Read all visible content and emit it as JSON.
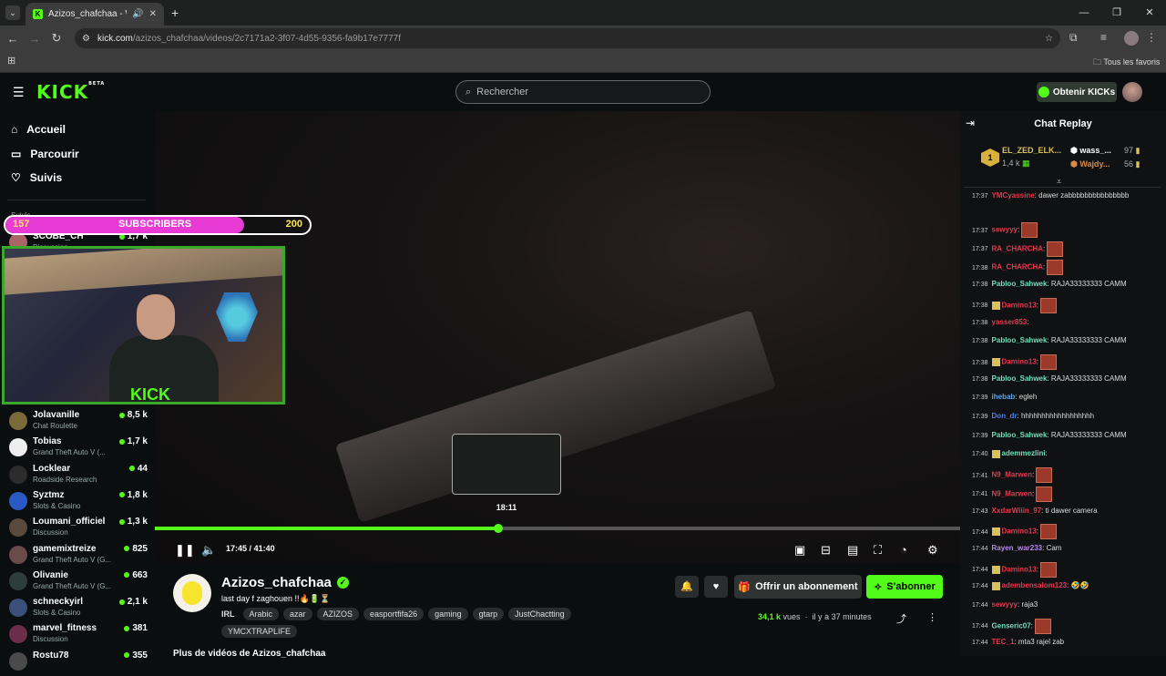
{
  "browser": {
    "tab_title": "Azizos_chafchaa - Watch th",
    "url_host": "kick.com",
    "url_path": "/azizos_chafchaa/videos/2c7171a2-3f07-4d55-9356-fa9b17e7777f",
    "bookmarks_label": "Tous les favoris"
  },
  "header": {
    "logo": "KICK",
    "logo_sup": "BETA",
    "search_placeholder": "Rechercher",
    "kicks_label": "Obtenir KICKs"
  },
  "sidebar": {
    "nav": [
      {
        "label": "Accueil",
        "icon": "home-icon"
      },
      {
        "label": "Parcourir",
        "icon": "compass-icon"
      },
      {
        "label": "Suivis",
        "icon": "heart-icon"
      }
    ],
    "section": "Suivis",
    "partial_channel": {
      "name": "SCOBE_CH",
      "category": "Discussion",
      "viewers": "1,7 k"
    },
    "channels": [
      {
        "name": "Jolavanille",
        "category": "Chat Roulette",
        "viewers": "8,5 k",
        "color": "#7a6a3a"
      },
      {
        "name": "Tobias",
        "category": "Grand Theft Auto V (...",
        "viewers": "1,7 k",
        "color": "#eeeeee"
      },
      {
        "name": "Locklear",
        "category": "Roadside Research",
        "viewers": "44",
        "color": "#2c2c2c"
      },
      {
        "name": "Syztmz",
        "category": "Slots & Casino",
        "viewers": "1,8 k",
        "color": "#2b59c3"
      },
      {
        "name": "Loumani_officiel",
        "category": "Discussion",
        "viewers": "1,3 k",
        "color": "#5a4a3e"
      },
      {
        "name": "gamemixtreize",
        "category": "Grand Theft Auto V (G...",
        "viewers": "825",
        "color": "#6b4a4a"
      },
      {
        "name": "Olivanie",
        "category": "Grand Theft Auto V (G...",
        "viewers": "663",
        "color": "#2d3d3a"
      },
      {
        "name": "schneckyirl",
        "category": "Slots & Casino",
        "viewers": "2,1 k",
        "color": "#3c4f7a"
      },
      {
        "name": "marvel_fitness",
        "category": "Discussion",
        "viewers": "381",
        "color": "#6a2d4a"
      },
      {
        "name": "Rostu78",
        "category": "",
        "viewers": "355",
        "color": "#4a4a4a"
      }
    ]
  },
  "overlay": {
    "sub_current": "157",
    "sub_label": "SUBSCRIBERS",
    "sub_goal": "200",
    "sub_progress": 0.785,
    "cam_logo": "KICK"
  },
  "player": {
    "hover_time": "18:11",
    "current_time": "17:45",
    "separator": "/",
    "duration": "41:40",
    "progress": 0.426,
    "controls": [
      "pause-icon",
      "volume-icon",
      "miniplayer-icon",
      "theater-icon",
      "pip-icon",
      "fullscreen-icon",
      "speed-icon",
      "settings-icon"
    ]
  },
  "info": {
    "streamer": "Azizos_chafchaa",
    "title": "last day f zaghouen !!🔥🔋⏳",
    "category": "IRL",
    "tags": [
      "Arabic",
      "azar",
      "AZIZOS",
      "easportfifa26",
      "gaming",
      "gtarp",
      "JustChactting",
      "YMCXTRAPLIFE"
    ],
    "subscribe_label": "Offrir un abonnement",
    "follow_label": "S'abonner",
    "views_count": "34,1 k",
    "views_label": "vues",
    "age": "il y a 37 minutes",
    "more_videos": "Plus de vidéos de Azizos_chafchaa"
  },
  "chat": {
    "title": "Chat Replay",
    "leader1": {
      "rank": "1",
      "name": "EL_ZED_ELK...",
      "amount": "1,4 k"
    },
    "leader2": {
      "name": "wass_...",
      "amount": "97"
    },
    "leader3": {
      "name": "Wajdy...",
      "amount": "56"
    },
    "messages": [
      {
        "time": "17:37",
        "user": "YMCyassine",
        "color": "#e8384f",
        "text": ": dawer zabbbbbbbbbbbbbbb",
        "emote": false,
        "badge": false
      },
      {
        "time": "17:37",
        "user": "sewyyy",
        "color": "#e8384f",
        "text": ":",
        "emote": true,
        "badge": false
      },
      {
        "time": "17:37",
        "user": "RA_CHARCHA",
        "color": "#e8384f",
        "text": ":",
        "emote": true,
        "badge": false
      },
      {
        "time": "17:38",
        "user": "RA_CHARCHA",
        "color": "#e8384f",
        "text": ":",
        "emote": true,
        "badge": false
      },
      {
        "time": "17:38",
        "user": "Pabloo_Sahwek",
        "color": "#70e0b8",
        "text": ": RAJA33333333 CAMM",
        "emote": false,
        "badge": false
      },
      {
        "time": "17:38",
        "user": "Damino13",
        "color": "#e8384f",
        "text": ":",
        "emote": true,
        "badge": true
      },
      {
        "time": "17:38",
        "user": "yasser853",
        "color": "#e8384f",
        "text": ":",
        "emote": false,
        "badge": false
      },
      {
        "time": "17:38",
        "user": "Pabloo_Sahwek",
        "color": "#70e0b8",
        "text": ": RAJA33333333 CAMM",
        "emote": false,
        "badge": false
      },
      {
        "time": "17:38",
        "user": "Damino13",
        "color": "#e8384f",
        "text": ":",
        "emote": true,
        "badge": true
      },
      {
        "time": "17:38",
        "user": "Pabloo_Sahwek",
        "color": "#70e0b8",
        "text": ": RAJA33333333 CAMM",
        "emote": false,
        "badge": false
      },
      {
        "time": "17:39",
        "user": "ihebab",
        "color": "#5fa4e8",
        "text": ": egleh",
        "emote": false,
        "badge": false
      },
      {
        "time": "17:39",
        "user": "Don_dr",
        "color": "#4f7ee8",
        "text": ": hhhhhhhhhhhhhhhhhh",
        "emote": false,
        "badge": false
      },
      {
        "time": "17:39",
        "user": "Pabloo_Sahwek",
        "color": "#70e0b8",
        "text": ": RAJA33333333 CAMM",
        "emote": false,
        "badge": false
      },
      {
        "time": "17:40",
        "user": "ademmezlini",
        "color": "#70e0b8",
        "text": ":",
        "emote": false,
        "badge": true
      },
      {
        "time": "17:41",
        "user": "N9_Marwen",
        "color": "#e8384f",
        "text": ":",
        "emote": true,
        "badge": false
      },
      {
        "time": "17:41",
        "user": "N9_Marwen",
        "color": "#e8384f",
        "text": ":",
        "emote": true,
        "badge": false
      },
      {
        "time": "17:43",
        "user": "XxdarWiiin_97",
        "color": "#e8384f",
        "text": ": ti dawer camera",
        "emote": false,
        "badge": false
      },
      {
        "time": "17:44",
        "user": "Damino13",
        "color": "#e8384f",
        "text": ":",
        "emote": true,
        "badge": true
      },
      {
        "time": "17:44",
        "user": "Rayen_war233",
        "color": "#b88ae8",
        "text": ": Cam",
        "emote": false,
        "badge": false
      },
      {
        "time": "17:44",
        "user": "Damino13",
        "color": "#e8384f",
        "text": ":",
        "emote": true,
        "badge": true
      },
      {
        "time": "17:44",
        "user": "adembensalom123",
        "color": "#e8384f",
        "text": ": 🤣🤣",
        "emote": false,
        "badge": true
      },
      {
        "time": "17:44",
        "user": "sewyyy",
        "color": "#e8384f",
        "text": ": raja3",
        "emote": false,
        "badge": false
      },
      {
        "time": "17:44",
        "user": "Genseric07",
        "color": "#70e0b8",
        "text": ":",
        "emote": true,
        "badge": false
      },
      {
        "time": "17:44",
        "user": "TEC_1",
        "color": "#e8384f",
        "text": ": mta3 rajel zab",
        "emote": false,
        "badge": false
      }
    ]
  }
}
